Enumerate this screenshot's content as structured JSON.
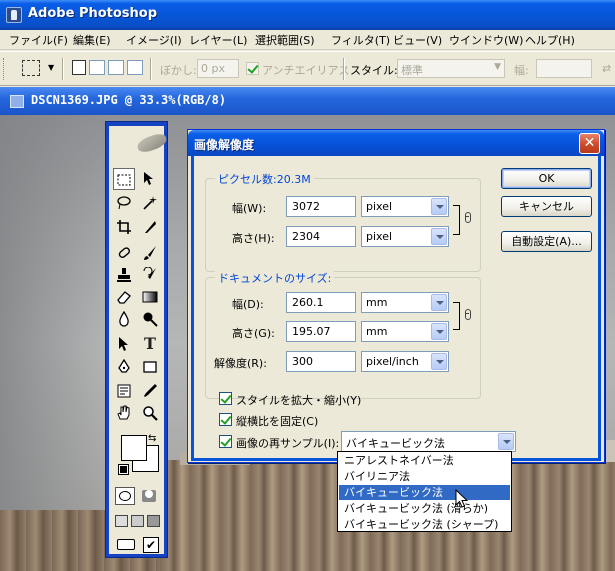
{
  "app": {
    "title": "Adobe Photoshop"
  },
  "menubar": {
    "items": [
      "ファイル(F)",
      "編集(E)",
      "イメージ(I)",
      "レイヤー(L)",
      "選択範囲(S)",
      "フィルタ(T)",
      "ビュー(V)",
      "ウインドウ(W)",
      "ヘルプ(H)"
    ]
  },
  "options": {
    "feather_label": "ぼかし:",
    "feather_value": "0 px",
    "antialias_label": "アンチエイリアス",
    "style_label": "スタイル:",
    "style_value": "標準",
    "width_label": "幅:"
  },
  "document": {
    "title": "DSCN1369.JPG @ 33.3%(RGB/8)"
  },
  "dialog": {
    "title": "画像解像度",
    "close_glyph": "✕",
    "pixel_group": {
      "legend": "ピクセル数:20.3M",
      "width_label": "幅(W):",
      "width_value": "3072",
      "width_unit": "pixel",
      "height_label": "高さ(H):",
      "height_value": "2304",
      "height_unit": "pixel"
    },
    "doc_group": {
      "legend": "ドキュメントのサイズ:",
      "width_label": "幅(D):",
      "width_value": "260.1",
      "width_unit": "mm",
      "height_label": "高さ(G):",
      "height_value": "195.07",
      "height_unit": "mm",
      "res_label": "解像度(R):",
      "res_value": "300",
      "res_unit": "pixel/inch"
    },
    "checks": {
      "scale_styles": "スタイルを拡大・縮小(Y)",
      "constrain": "縦横比を固定(C)",
      "resample": "画像の再サンプル(I):"
    },
    "resample_value": "バイキュービック法",
    "buttons": {
      "ok": "OK",
      "cancel": "キャンセル",
      "auto": "自動設定(A)..."
    }
  },
  "resample_options": [
    "ニアレストネイバー法",
    "バイリニア法",
    "バイキュービック法",
    "バイキュービック法 (滑らか)",
    "バイキュービック法 (シャープ)"
  ],
  "colors": {
    "accent": "#0553d8",
    "highlight": "#316ac5",
    "link": "#0046d5"
  }
}
